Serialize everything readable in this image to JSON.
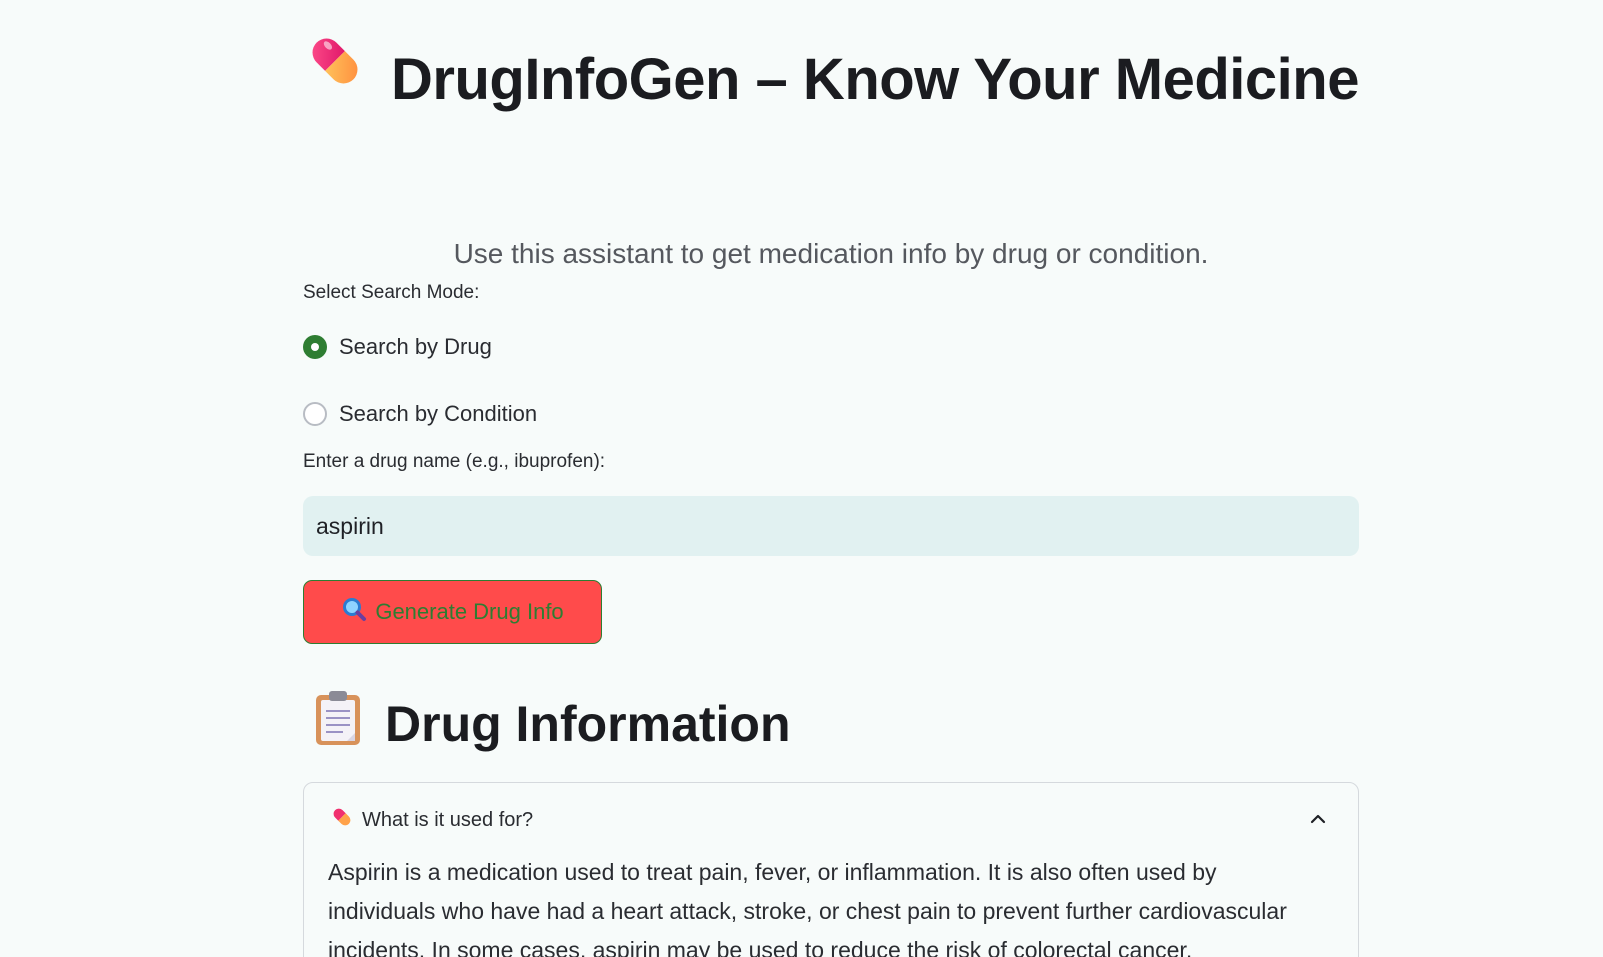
{
  "header": {
    "title": "DrugInfoGen – Know Your Medicine",
    "title_icon": "pill-icon",
    "subtitle": "Use this assistant to get medication info by drug or condition."
  },
  "search_mode": {
    "label": "Select Search Mode:",
    "options": [
      {
        "label": "Search by Drug",
        "selected": true
      },
      {
        "label": "Search by Condition",
        "selected": false
      }
    ]
  },
  "drug_input": {
    "label": "Enter a drug name (e.g., ibuprofen):",
    "value": "aspirin"
  },
  "generate_button": {
    "icon": "magnifier-icon",
    "label": "Generate Drug Info"
  },
  "results": {
    "heading_icon": "clipboard-icon",
    "heading": "Drug Information",
    "sections": [
      {
        "icon": "pill-icon",
        "title": "What is it used for?",
        "expanded": true,
        "body": "Aspirin is a medication used to treat pain, fever, or inflammation. It is also often used by individuals who have had a heart attack, stroke, or chest pain to prevent further cardiovascular incidents. In some cases, aspirin may be used to reduce the risk of colorectal cancer."
      }
    ]
  },
  "colors": {
    "background": "#f7fbfa",
    "radio_selected": "#2e7d32",
    "input_background": "#e1f1f1",
    "button_background": "#ff4b4b",
    "button_text": "#2e7d32"
  }
}
